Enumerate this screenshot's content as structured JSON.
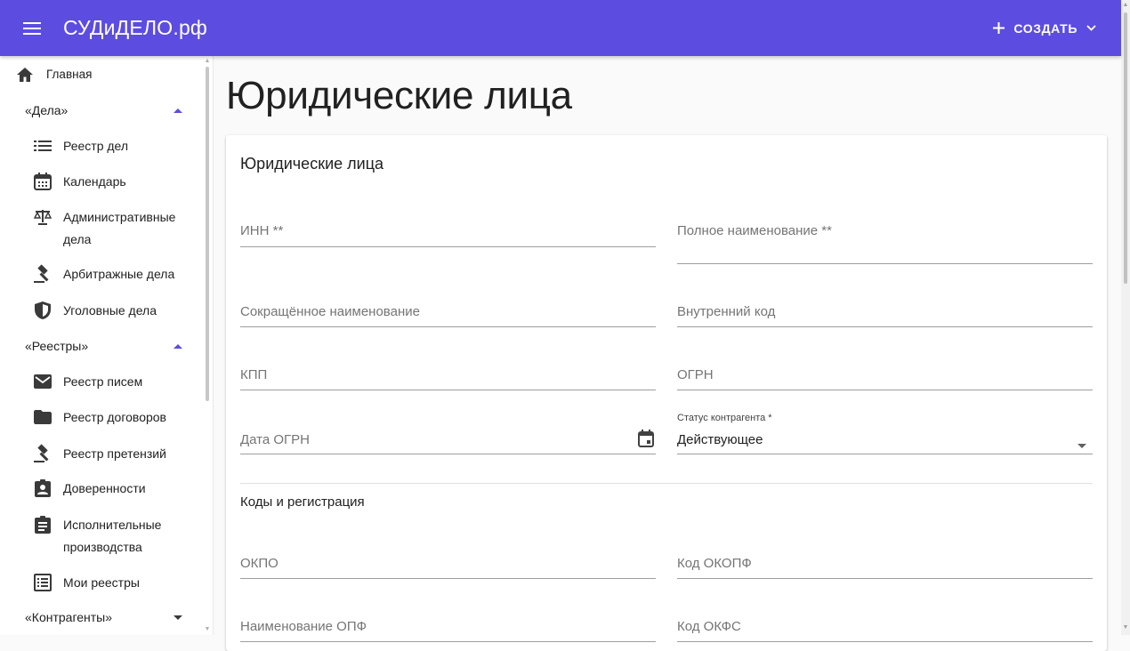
{
  "app": {
    "brand": "СУДиДЕЛО.рф",
    "create_label": "СОЗДАТЬ",
    "colors": {
      "primary": "#5c4de0",
      "accent_triangle": "#5c4de0"
    }
  },
  "sidebar": {
    "home": "Главная",
    "groups": [
      {
        "label": "«Дела»",
        "state": "expanded"
      },
      {
        "label": "«Реестры»",
        "state": "expanded"
      },
      {
        "label": "«Контрагенты»",
        "state": "collapsed"
      }
    ],
    "cases": [
      {
        "label": "Реестр дел",
        "icon": "list-icon"
      },
      {
        "label": "Календарь",
        "icon": "calendar-icon"
      },
      {
        "label_line1": "Административные",
        "label_line2": "дела",
        "icon": "scales-icon"
      },
      {
        "label": "Арбитражные дела",
        "icon": "gavel-icon"
      },
      {
        "label": "Уголовные дела",
        "icon": "shield-icon"
      }
    ],
    "registries": [
      {
        "label": "Реестр писем",
        "icon": "mail-icon"
      },
      {
        "label": "Реестр договоров",
        "icon": "folder-icon"
      },
      {
        "label": "Реестр претензий",
        "icon": "gavel-icon"
      },
      {
        "label": "Доверенности",
        "icon": "badge-icon"
      },
      {
        "label_line1": "Исполнительные",
        "label_line2": "производства",
        "icon": "clipboard-icon"
      },
      {
        "label": "Мои реестры",
        "icon": "list-box-icon"
      }
    ]
  },
  "main": {
    "page_title": "Юридические лица",
    "card_title": "Юридические лица",
    "fields": {
      "inn": "ИНН **",
      "full_name": "Полное наименование **",
      "short_name": "Сокращённое наименование",
      "internal_code": "Внутренний код",
      "kpp": "КПП",
      "ogrn": "ОГРН",
      "ogrn_date": "Дата ОГРН",
      "status_label": "Статус контрагента *",
      "status_value": "Действующее"
    },
    "section_title": "Коды и регистрация",
    "section_fields": {
      "okpo": "ОКПО",
      "okopf_code": "Код ОКОПФ",
      "opf_name": "Наименование ОПФ",
      "okfs_code": "Код ОКФС"
    }
  }
}
